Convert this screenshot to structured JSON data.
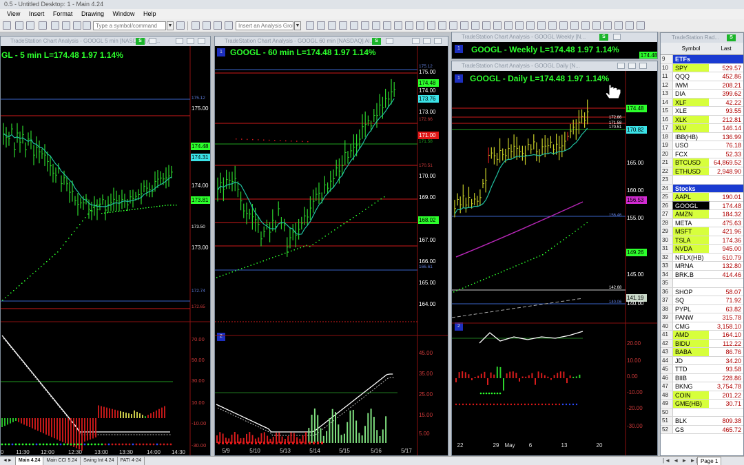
{
  "app": {
    "title": "0.5 - Untitled Desktop: 1 - Main 4.24"
  },
  "menu": [
    "View",
    "Insert",
    "Format",
    "Drawing",
    "Window",
    "Help"
  ],
  "toolbar": {
    "symbol_placeholder": "Type a symbol/command",
    "analysis_placeholder": "Insert an Analysis Group"
  },
  "colors": {
    "up": "#2cff2c",
    "down": "#e01818",
    "grid": "#8b1111",
    "accent_blue": "#1a3bd1"
  },
  "charts": {
    "c5": {
      "title": "TradeStation Chart Analysis - GOOGL 5 min [NASDAQ] Alp...",
      "heading": "GL - 5 min  L=174.48  1.97  1.14%",
      "s": "S",
      "price_labels": [
        "175.12",
        "175.00",
        "174.48",
        "174.31",
        "174.00",
        "173.81",
        "173.50",
        "173.00",
        "172.74",
        "172.65"
      ],
      "ind_labels": [
        "70.00",
        "50.00",
        "30.00",
        "10.00",
        "-10.00",
        "-30.00"
      ],
      "x_labels": [
        "0",
        "11:30",
        "12:00",
        "12:30",
        "13:00",
        "13:30",
        "14:00",
        "14:30"
      ]
    },
    "c60": {
      "title": "TradeStation Chart Analysis - GOOGL 60 min [NASDAQ] Al...",
      "heading": "GOOGL - 60 min  L=174.48  1.97  1.14%",
      "s": "S",
      "badge": "1",
      "badge2": "2",
      "price_labels": [
        "175.12",
        "175.00",
        "174.48",
        "174.00",
        "173.76",
        "173.00",
        "172.66",
        "171.58",
        "171.00",
        "170.51",
        "170.00",
        "169.00",
        "168.02",
        "167.00",
        "166.61",
        "166.00",
        "165.00",
        "164.00"
      ],
      "ind_labels": [
        "45.00",
        "35.00",
        "25.00",
        "15.00",
        "5.00"
      ],
      "x_labels": [
        "5/9",
        "5/10",
        "5/13",
        "5/14",
        "5/15",
        "5/16",
        "5/17"
      ]
    },
    "cw": {
      "title": "TradeStation Chart Analysis - GOOGL Weekly [N...",
      "heading": "GOOGL - Weekly  L=174.48  1.97  1.14%",
      "s": "S",
      "badge": "1",
      "price": "174.48"
    },
    "cd": {
      "title": "TradeStation Chart Analysis - GOOGL Daily [N...",
      "heading": "GOOGL - Daily  L=174.48  1.97  1.14%",
      "badge": "1",
      "badge2": "2",
      "price_labels": [
        "174.48",
        "172.66",
        "171.58",
        "170.82",
        "170.51",
        "165.00",
        "160.00",
        "156.53",
        "156.46",
        "155.00",
        "149.26",
        "145.00",
        "142.68",
        "141.19",
        "140.06",
        "140.00"
      ],
      "ind_labels": [
        "20.00",
        "10.00",
        "0.00",
        "-10.00",
        "-20.00",
        "-30.00"
      ],
      "x_labels": [
        "22",
        "29",
        "May",
        "6",
        "13",
        "20"
      ]
    }
  },
  "radar": {
    "title": "TradeStation Rad...",
    "s": "S",
    "col_symbol": "Symbol",
    "col_last": "Last",
    "rows": [
      {
        "i": "9",
        "s": "ETFs",
        "l": "",
        "sec": true
      },
      {
        "i": "10",
        "s": "SPY",
        "l": "529.57",
        "hl": true
      },
      {
        "i": "11",
        "s": "QQQ",
        "l": "452.86"
      },
      {
        "i": "12",
        "s": "IWM",
        "l": "208.21"
      },
      {
        "i": "13",
        "s": "DIA",
        "l": "399.62"
      },
      {
        "i": "14",
        "s": "XLF",
        "l": "42.22",
        "hl": true
      },
      {
        "i": "15",
        "s": "XLE",
        "l": "93.55"
      },
      {
        "i": "16",
        "s": "XLK",
        "l": "212.81",
        "hl": true
      },
      {
        "i": "17",
        "s": "XLV",
        "l": "146.14",
        "hl": true
      },
      {
        "i": "18",
        "s": "IBB(HB)",
        "l": "136.99"
      },
      {
        "i": "19",
        "s": "USO",
        "l": "76.18"
      },
      {
        "i": "20",
        "s": "FCX",
        "l": "52.33"
      },
      {
        "i": "21",
        "s": "BTCUSD",
        "l": "64,869.52",
        "hl": true
      },
      {
        "i": "22",
        "s": "ETHUSD",
        "l": "2,948.90",
        "hl": true
      },
      {
        "i": "23",
        "s": "",
        "l": ""
      },
      {
        "i": "24",
        "s": "Stocks",
        "l": "",
        "sec": true
      },
      {
        "i": "25",
        "s": "AAPL",
        "l": "190.01",
        "hl": true
      },
      {
        "i": "26",
        "s": "GOOGL",
        "l": "174.48",
        "sel": true
      },
      {
        "i": "27",
        "s": "AMZN",
        "l": "184.32",
        "hl": true
      },
      {
        "i": "28",
        "s": "META",
        "l": "475.63"
      },
      {
        "i": "29",
        "s": "MSFT",
        "l": "421.96",
        "hl": true
      },
      {
        "i": "30",
        "s": "TSLA",
        "l": "174.36",
        "hl": true
      },
      {
        "i": "31",
        "s": "NVDA",
        "l": "945.00",
        "hl": true
      },
      {
        "i": "32",
        "s": "NFLX(HB)",
        "l": "610.79"
      },
      {
        "i": "33",
        "s": "MRNA",
        "l": "132.80"
      },
      {
        "i": "34",
        "s": "BRK.B",
        "l": "414.46"
      },
      {
        "i": "35",
        "s": "",
        "l": ""
      },
      {
        "i": "36",
        "s": "SHOP",
        "l": "58.07"
      },
      {
        "i": "37",
        "s": "SQ",
        "l": "71.92"
      },
      {
        "i": "38",
        "s": "PYPL",
        "l": "63.82"
      },
      {
        "i": "39",
        "s": "PANW",
        "l": "315.78"
      },
      {
        "i": "40",
        "s": "CMG",
        "l": "3,158.10"
      },
      {
        "i": "41",
        "s": "AMD",
        "l": "164.10",
        "hl": true
      },
      {
        "i": "42",
        "s": "BIDU",
        "l": "112.22",
        "hl": true
      },
      {
        "i": "43",
        "s": "BABA",
        "l": "86.76",
        "hl": true
      },
      {
        "i": "44",
        "s": "JD",
        "l": "34.20"
      },
      {
        "i": "45",
        "s": "TTD",
        "l": "93.58"
      },
      {
        "i": "46",
        "s": "BIIB",
        "l": "228.86"
      },
      {
        "i": "47",
        "s": "BKNG",
        "l": "3,754.78"
      },
      {
        "i": "48",
        "s": "COIN",
        "l": "201.22",
        "hl": true
      },
      {
        "i": "49",
        "s": "GME(HB)",
        "l": "30.71",
        "hl": true
      },
      {
        "i": "50",
        "s": "",
        "l": ""
      },
      {
        "i": "51",
        "s": "BLK",
        "l": "809.38"
      },
      {
        "i": "52",
        "s": "GS",
        "l": "465.72"
      }
    ],
    "page_label": "Page 1"
  },
  "tabs": [
    "Main 4.24",
    "Main CCI 5.24",
    "Swing Int 4.24",
    "PATI 4-24"
  ]
}
